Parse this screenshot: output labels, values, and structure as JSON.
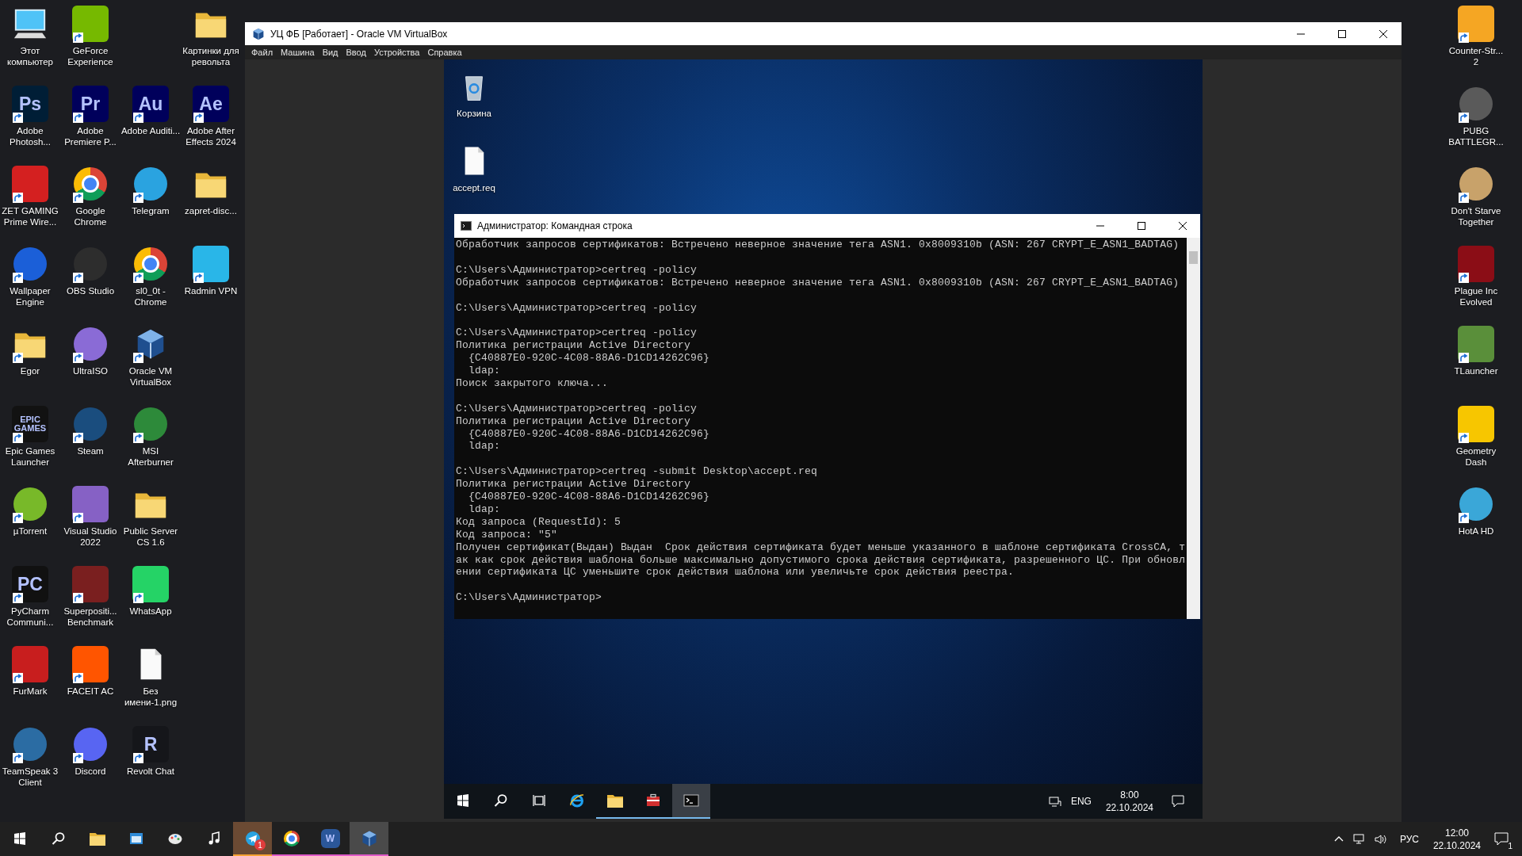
{
  "left_icons": [
    [
      {
        "label": "Этот компьютер",
        "kind": "computer",
        "shortcut": false
      },
      {
        "label": "Adobe Photosh...",
        "kind": "tile",
        "color": "#001e36",
        "glyph": "Ps",
        "shortcut": true
      },
      {
        "label": "ZET GAMING Prime Wire...",
        "kind": "tile",
        "color": "#d42020",
        "shortcut": true
      },
      {
        "label": "Wallpaper Engine",
        "kind": "round",
        "color": "#1b5fd8",
        "shortcut": true
      },
      {
        "label": "Egor",
        "kind": "folder",
        "shortcut": true
      },
      {
        "label": "Epic Games Launcher",
        "kind": "tile",
        "color": "#121212",
        "glyph": "EPIC GAMES",
        "shortcut": true
      },
      {
        "label": "µTorrent",
        "kind": "round",
        "color": "#78b929",
        "shortcut": true
      },
      {
        "label": "PyCharm Communi...",
        "kind": "tile",
        "color": "#111111",
        "glyph": "PC",
        "shortcut": true
      },
      {
        "label": "FurMark",
        "kind": "tile",
        "color": "#c81e1e",
        "shortcut": true
      },
      {
        "label": "TeamSpeak 3 Client",
        "kind": "round",
        "color": "#2b6ca3",
        "shortcut": true
      }
    ],
    [
      {
        "label": "GeForce Experience",
        "kind": "tile",
        "color": "#76b900",
        "shortcut": true
      },
      {
        "label": "Adobe Premiere P...",
        "kind": "tile",
        "color": "#00005b",
        "glyph": "Pr",
        "shortcut": true
      },
      {
        "label": "Google Chrome",
        "kind": "chrome",
        "shortcut": true
      },
      {
        "label": "OBS Studio",
        "kind": "round",
        "color": "#2d2d2d",
        "shortcut": true
      },
      {
        "label": "UltraISO",
        "kind": "round",
        "color": "#8a6bd6",
        "shortcut": true
      },
      {
        "label": "Steam",
        "kind": "round",
        "color": "#1a4d7e",
        "shortcut": true
      },
      {
        "label": "Visual Studio 2022",
        "kind": "tile",
        "color": "#8661c5",
        "shortcut": true
      },
      {
        "label": "Superpositi... Benchmark",
        "kind": "tile",
        "color": "#7a1f1f",
        "shortcut": true
      },
      {
        "label": "FACEIT AC",
        "kind": "tile",
        "color": "#ff5500",
        "shortcut": true
      },
      {
        "label": "Discord",
        "kind": "round",
        "color": "#5865f2",
        "shortcut": true
      }
    ],
    [
      {
        "label": "Adobe Auditi...",
        "kind": "tile",
        "color": "#00005b",
        "glyph": "Au",
        "shortcut": true
      },
      {
        "label": "Telegram",
        "kind": "round",
        "color": "#2aa3e0",
        "shortcut": true
      },
      {
        "label": "sl0_0t - Chrome",
        "kind": "chrome",
        "shortcut": true
      },
      {
        "label": "Oracle VM VirtualBox",
        "kind": "cube",
        "shortcut": true
      },
      {
        "label": "MSI Afterburner",
        "kind": "round",
        "color": "#2d8a3a",
        "shortcut": true
      },
      {
        "label": "Public Server CS 1.6",
        "kind": "folder",
        "shortcut": false
      },
      {
        "label": "WhatsApp",
        "kind": "tile",
        "color": "#25d366",
        "shortcut": true
      },
      {
        "label": "Без имени-1.png",
        "kind": "file",
        "shortcut": false
      },
      {
        "label": "Revolt Chat",
        "kind": "tile",
        "color": "#15161a",
        "glyph": "R",
        "shortcut": true
      }
    ],
    [
      {
        "label": "Картинки для револьта",
        "kind": "folder",
        "shortcut": false
      },
      {
        "label": "Adobe After Effects 2024",
        "kind": "tile",
        "color": "#00005b",
        "glyph": "Ae",
        "shortcut": true
      },
      {
        "label": "zapret-disc...",
        "kind": "folder",
        "shortcut": false
      },
      {
        "label": "Radmin VPN",
        "kind": "tile",
        "color": "#29b6e8",
        "shortcut": true
      }
    ]
  ],
  "right_icons": [
    {
      "label": "Counter-Str... 2",
      "kind": "tile",
      "color": "#f5a623",
      "shortcut": true
    },
    {
      "label": "PUBG BATTLEGR...",
      "kind": "round",
      "color": "#5a5a5a",
      "shortcut": true
    },
    {
      "label": "Don't Starve Together",
      "kind": "round",
      "color": "#c8a26a",
      "shortcut": true
    },
    {
      "label": "Plague Inc Evolved",
      "kind": "tile",
      "color": "#8b0d16",
      "shortcut": true
    },
    {
      "label": "TLauncher",
      "kind": "tile",
      "color": "#5a8f3a",
      "shortcut": true
    },
    {
      "label": "Geometry Dash",
      "kind": "tile",
      "color": "#f7c600",
      "shortcut": true
    },
    {
      "label": "HotA HD",
      "kind": "round",
      "color": "#3aa7d8",
      "shortcut": true
    }
  ],
  "vm_window": {
    "title": "УЦ ФБ [Работает] - Oracle VM VirtualBox",
    "menu": [
      "Файл",
      "Машина",
      "Вид",
      "Ввод",
      "Устройства",
      "Справка"
    ],
    "guest": {
      "icons": [
        {
          "label": "Корзина",
          "kind": "bin"
        },
        {
          "label": "accept.req",
          "kind": "file"
        }
      ],
      "cmd": {
        "title": "Администратор: Командная строка",
        "blocks": [
          [
            "Обработчик запросов сертификатов: Встречено неверное значение тега ASN1. 0x8009310b (ASN: 267 CRYPT_E_ASN1_BADTAG)"
          ],
          [
            "C:\\Users\\Администратор>certreq -policy",
            "Обработчик запросов сертификатов: Встречено неверное значение тега ASN1. 0x8009310b (ASN: 267 CRYPT_E_ASN1_BADTAG)"
          ],
          [
            "C:\\Users\\Администратор>certreq -policy"
          ],
          [
            "C:\\Users\\Администратор>certreq -policy",
            "Политика регистрации Active Directory",
            "  {C40887E0-920C-4C08-88A6-D1CD14262C96}",
            "  ldap:",
            "Поиск закрытого ключа..."
          ],
          [
            "C:\\Users\\Администратор>certreq -policy",
            "Политика регистрации Active Directory",
            "  {C40887E0-920C-4C08-88A6-D1CD14262C96}",
            "  ldap:"
          ],
          [
            "C:\\Users\\Администратор>certreq -submit Desktop\\accept.req",
            "Политика регистрации Active Directory",
            "  {C40887E0-920C-4C08-88A6-D1CD14262C96}",
            "  ldap:",
            "Код запроса (RequestId): 5",
            "Код запроса: \"5\"",
            "Получен сертификат(Выдан) Выдан  Срок действия сертификата будет меньше указанного в шаблоне сертификата CrossCA, т",
            "ак как срок действия шаблона больше максимально допустимого срока действия сертификата, разрешенного ЦС. При обновл",
            "ении сертификата ЦС уменьшите срок действия шаблона или увеличьте срок действия реестра."
          ]
        ],
        "prompt": "C:\\Users\\Администратор>"
      },
      "taskbar": {
        "items": [
          {
            "kind": "start",
            "running": false,
            "selected": false
          },
          {
            "kind": "search",
            "running": false,
            "selected": false
          },
          {
            "kind": "taskview",
            "running": false,
            "selected": false
          },
          {
            "kind": "ie",
            "running": false,
            "selected": false
          },
          {
            "kind": "folder",
            "running": true,
            "selected": false
          },
          {
            "kind": "toolbox",
            "running": true,
            "selected": false
          },
          {
            "kind": "terminal",
            "running": true,
            "selected": true
          }
        ],
        "language": "ENG",
        "time": "8:00",
        "date": "22.10.2024"
      }
    }
  },
  "host_taskbar": {
    "items": [
      {
        "kind": "start",
        "running": false,
        "selected": false,
        "flashing": false
      },
      {
        "kind": "search",
        "running": false,
        "selected": false,
        "flashing": false
      },
      {
        "kind": "folder",
        "running": false,
        "selected": false,
        "flashing": false
      },
      {
        "kind": "window",
        "running": false,
        "selected": false,
        "flashing": false
      },
      {
        "kind": "palette",
        "running": false,
        "selected": false,
        "flashing": false
      },
      {
        "kind": "note",
        "running": false,
        "selected": false,
        "flashing": false
      },
      {
        "kind": "plane",
        "running": false,
        "selected": false,
        "flashing": true,
        "badge": "1"
      },
      {
        "kind": "chrome",
        "running": true,
        "selected": false,
        "flashing": false
      },
      {
        "kind": "tile",
        "color": "#2b579a",
        "glyph": "W",
        "running": true,
        "selected": false,
        "flashing": false
      },
      {
        "kind": "cube",
        "running": true,
        "selected": true,
        "flashing": false
      }
    ],
    "language": "РУС",
    "time": "12:00",
    "date": "22.10.2024",
    "notifications": "1"
  }
}
